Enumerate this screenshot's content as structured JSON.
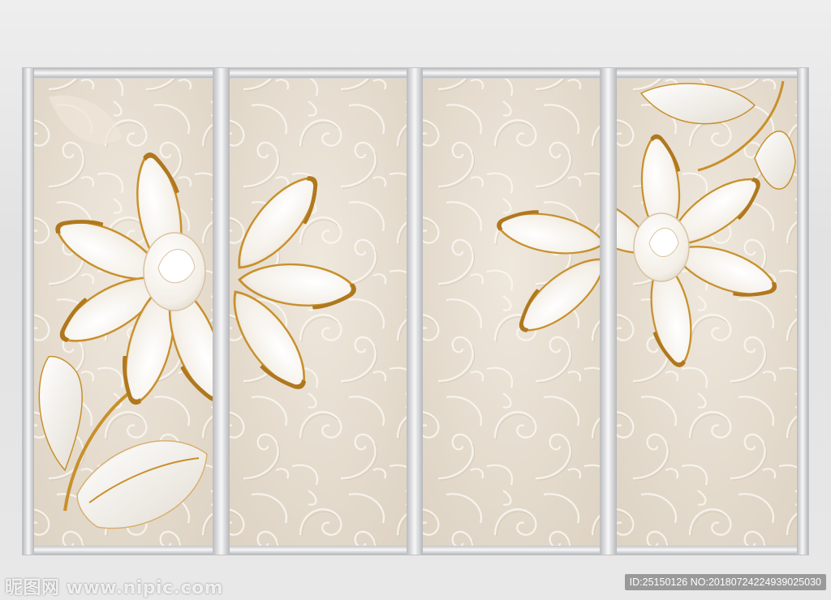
{
  "watermark": {
    "site": "昵图网 www.nipic.com",
    "id_text": "ID:25150126 NO:20180724224939025030"
  },
  "palette": {
    "frame": "#d9dadc",
    "panel_bg": "#e8e0d4",
    "swirl": "#fbf8f2",
    "petal": "#fbf9f5",
    "petal_shade": "#e6ded2",
    "gold": "#c8902c",
    "leaf": "#f4f1ec"
  }
}
